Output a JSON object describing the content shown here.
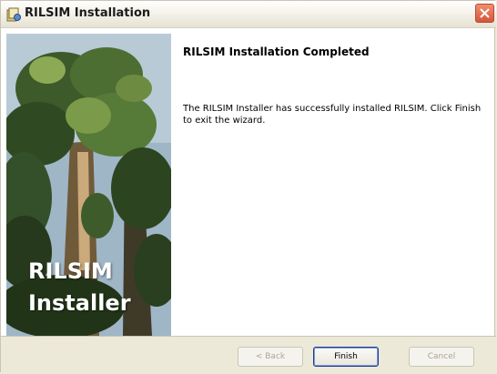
{
  "window": {
    "title": "RILSIM Installation",
    "icon": "installer-icon",
    "close_icon": "close-icon"
  },
  "side_panel": {
    "brand_line1": "RILSIM",
    "brand_line2": "Installer"
  },
  "content": {
    "heading": "RILSIM Installation Completed",
    "message": "The RILSIM Installer has successfully installed RILSIM. Click Finish to exit the wizard."
  },
  "buttons": {
    "back": "< Back",
    "finish": "Finish",
    "cancel": "Cancel"
  },
  "colors": {
    "window_bg": "#ece9d8",
    "close_button": "#d5553a"
  }
}
